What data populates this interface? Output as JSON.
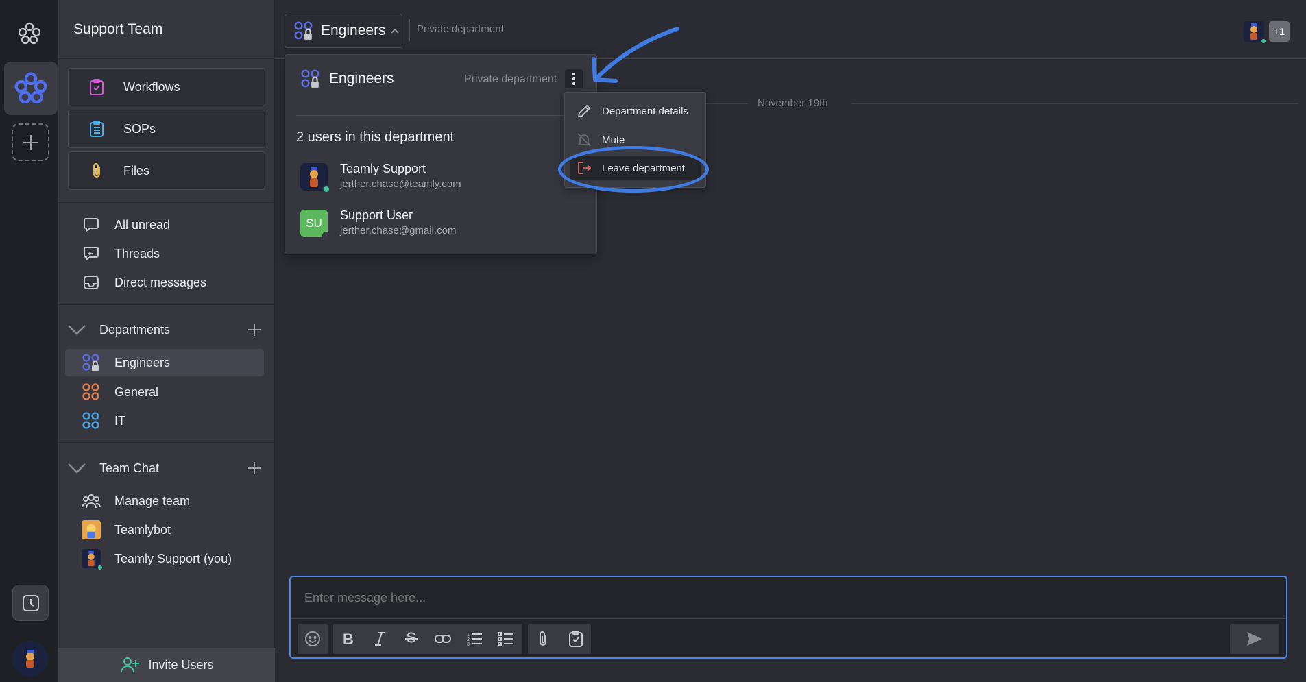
{
  "workspace": {
    "name": "Support Team"
  },
  "sidebar": {
    "buttons": [
      {
        "label": "Workflows"
      },
      {
        "label": "SOPs"
      },
      {
        "label": "Files"
      }
    ],
    "nav": [
      {
        "label": "All unread"
      },
      {
        "label": "Threads"
      },
      {
        "label": "Direct messages"
      }
    ],
    "departments": {
      "title": "Departments",
      "items": [
        {
          "label": "Engineers",
          "color": "#5b6ee8",
          "active": true
        },
        {
          "label": "General",
          "color": "#e8804a"
        },
        {
          "label": "IT",
          "color": "#4aa8e8"
        }
      ]
    },
    "team_chat": {
      "title": "Team Chat",
      "items": [
        {
          "label": "Manage team"
        },
        {
          "label": "Teamlybot"
        },
        {
          "label": "Teamly Support (you)"
        }
      ]
    },
    "invite_label": "Invite Users"
  },
  "header": {
    "department": "Engineers",
    "visibility": "Private department",
    "extra_members": "+1"
  },
  "date_divider": "November 19th",
  "dept_popup": {
    "title": "Engineers",
    "visibility": "Private department",
    "count_label": "2 users in this department",
    "users": [
      {
        "name": "Teamly Support",
        "email": "jerther.chase@teamly.com",
        "status": "online"
      },
      {
        "name": "Support User",
        "initials": "SU",
        "email": "jerther.chase@gmail.com",
        "status": "offline"
      }
    ]
  },
  "dept_menu": {
    "items": [
      {
        "label": "Department details",
        "icon": "pencil-icon"
      },
      {
        "label": "Mute",
        "icon": "bell-off-icon"
      },
      {
        "label": "Leave department",
        "icon": "exit-icon"
      }
    ]
  },
  "composer": {
    "placeholder": "Enter message here..."
  },
  "colors": {
    "accent": "#4a86ea",
    "online": "#46c4a0",
    "su_avatar": "#5cb85c",
    "danger": "#e06a6a"
  }
}
